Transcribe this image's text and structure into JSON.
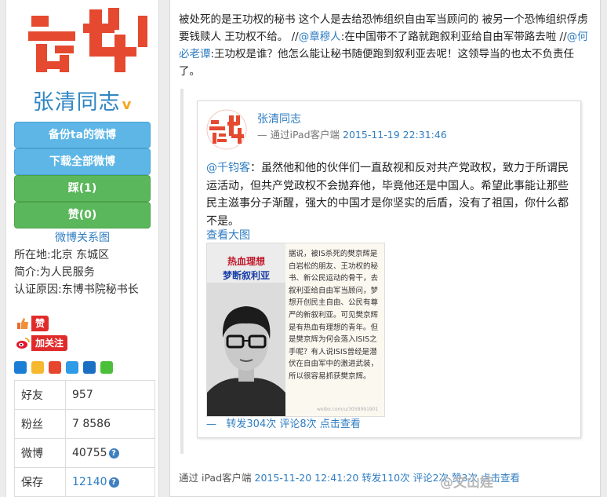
{
  "sidebar": {
    "name": "张清同志",
    "verified_mark": "v",
    "buttons": [
      {
        "label": "备份ta的微博",
        "color": "#5db6e5"
      },
      {
        "label": "下载全部微博",
        "color": "#5db6e5"
      },
      {
        "label": "踩(1)",
        "color": "#5bb75b"
      },
      {
        "label": "赞(0)",
        "color": "#5bb75b"
      }
    ],
    "relation_link": "微博关系图",
    "location": "所在地:北京 东城区",
    "intro": "简介:为人民服务",
    "verify_reason": "认证原因:东博书院秘书长",
    "like_label": "赞",
    "follow_label": "加关注",
    "stats": [
      {
        "key": "好友",
        "value": "957",
        "help": false,
        "link": false
      },
      {
        "key": "粉丝",
        "value": "7 8586",
        "help": false,
        "link": false
      },
      {
        "key": "微博",
        "value": "40755",
        "help": true,
        "link": false
      },
      {
        "key": "保存",
        "value": "12140",
        "help": true,
        "link": true
      }
    ]
  },
  "post": {
    "text_part1": "被处死的是王功权的秘书 这个人是去给恐怖组织自由军当顾问的 被另一个恐怖组织俘虏 要钱赎人 王功权不给。 //",
    "mention1": "@章穆人",
    "text_part2": ":在中国带不了路就跑叙利亚给自由军带路去啦 //",
    "mention2": "@何必老谭",
    "text_part3": ":王功权是谁？他怎么能让秘书随便跑到叙利亚去呢！这领导当的也太不负责任了。",
    "footer_via": "通过 iPad客户端",
    "footer_time": "2015-11-20 12:41:20",
    "footer_repost": "转发110次",
    "footer_comment": "评论2次",
    "footer_like": "赞3次",
    "footer_view": "点击查看",
    "watermark": "@文山娃"
  },
  "repost": {
    "author": "张清同志",
    "via": "— 通过iPad客户端",
    "time": "2015-11-19 22:31:46",
    "mention": "@千钧客",
    "text": "：虽然他和他的伙伴们一直敌视和反对共产党政权，致力于所谓民运活动，但共产党政权不会抛弃他，毕竟他还是中国人。希望此事能让那些民主滋事分子渐醒，强大的中国才是你坚实的后盾，没有了祖国，你什么都不是。",
    "view_image": "查看大图",
    "image_title1": "热血理想",
    "image_title2": "梦断叙利亚",
    "image_caption": "据说，被IS杀死的樊京辉是白岩松的朋友、王功权的秘书、新公民运动的骨干，去叙利亚给自由军当顾问，梦想开创民主自由、公民有尊严的新叙利亚。可见樊京辉是有热血有理想的青年。但是樊京辉为何会落入ISIS之手呢？有人说ISIS曾经是潜伏在自由军中的激进武装，所以很容易抓获樊京辉。",
    "image_watermark": "weibo.com/u/3058991901",
    "foot_dash": "—",
    "foot_repost": "转发304次",
    "foot_comment": "评论8次",
    "foot_view": "点击查看"
  },
  "colors": {
    "link": "#2f7dc2",
    "seal_red": "#e5492f",
    "btn_blue": "#5db6e5",
    "btn_green": "#5bb75b"
  }
}
